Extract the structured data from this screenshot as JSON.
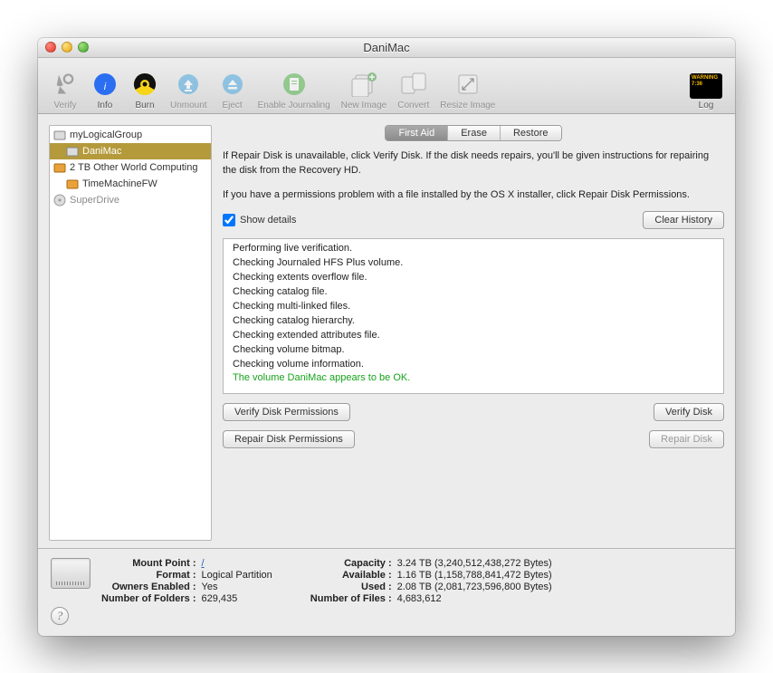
{
  "window": {
    "title": "DaniMac"
  },
  "toolbar": {
    "items": [
      {
        "id": "verify",
        "label": "Verify",
        "enabled": false
      },
      {
        "id": "info",
        "label": "Info",
        "enabled": true
      },
      {
        "id": "burn",
        "label": "Burn",
        "enabled": true
      },
      {
        "id": "unmount",
        "label": "Unmount",
        "enabled": false
      },
      {
        "id": "eject",
        "label": "Eject",
        "enabled": false
      },
      {
        "id": "journal",
        "label": "Enable Journaling",
        "enabled": false
      },
      {
        "id": "newimage",
        "label": "New Image",
        "enabled": false
      },
      {
        "id": "convert",
        "label": "Convert",
        "enabled": false
      },
      {
        "id": "resize",
        "label": "Resize Image",
        "enabled": false
      }
    ],
    "log_label": "Log",
    "log_text": "WARNING 7:36"
  },
  "sidebar": {
    "items": [
      {
        "label": "myLogicalGroup",
        "icon": "volume",
        "indent": 0,
        "selected": false,
        "dim": false
      },
      {
        "label": "DaniMac",
        "icon": "volume",
        "indent": 1,
        "selected": true,
        "dim": false
      },
      {
        "label": "2 TB Other World Computing",
        "icon": "disk-orange",
        "indent": 0,
        "selected": false,
        "dim": false
      },
      {
        "label": "TimeMachineFW",
        "icon": "disk-orange",
        "indent": 1,
        "selected": false,
        "dim": false
      },
      {
        "label": "SuperDrive",
        "icon": "optical",
        "indent": 0,
        "selected": false,
        "dim": true
      }
    ]
  },
  "tabs": {
    "items": [
      {
        "label": "First Aid",
        "active": true
      },
      {
        "label": "Erase",
        "active": false
      },
      {
        "label": "Restore",
        "active": false
      }
    ]
  },
  "panel": {
    "instructions_1": "If Repair Disk is unavailable, click Verify Disk. If the disk needs repairs, you'll be given instructions for repairing the disk from the Recovery HD.",
    "instructions_2": "If you have a permissions problem with a file installed by the OS X installer, click Repair Disk Permissions.",
    "show_details_label": "Show details",
    "show_details_checked": true,
    "clear_history_label": "Clear History",
    "log": [
      "Performing live verification.",
      "Checking Journaled HFS Plus volume.",
      "Checking extents overflow file.",
      "Checking catalog file.",
      "Checking multi-linked files.",
      "Checking catalog hierarchy.",
      "Checking extended attributes file.",
      "Checking volume bitmap.",
      "Checking volume information.",
      "The volume DaniMac appears to be OK."
    ],
    "log_ok_index": 9,
    "verify_perm_label": "Verify Disk Permissions",
    "repair_perm_label": "Repair Disk Permissions",
    "verify_disk_label": "Verify Disk",
    "repair_disk_label": "Repair Disk",
    "repair_disk_enabled": false
  },
  "footer": {
    "left": [
      {
        "k": "Mount Point",
        "v": "/",
        "link": true
      },
      {
        "k": "Format",
        "v": "Logical Partition"
      },
      {
        "k": "Owners Enabled",
        "v": "Yes"
      },
      {
        "k": "Number of Folders",
        "v": "629,435"
      }
    ],
    "right": [
      {
        "k": "Capacity",
        "v": "3.24 TB (3,240,512,438,272 Bytes)"
      },
      {
        "k": "Available",
        "v": "1.16 TB (1,158,788,841,472 Bytes)"
      },
      {
        "k": "Used",
        "v": "2.08 TB (2,081,723,596,800 Bytes)"
      },
      {
        "k": "Number of Files",
        "v": "4,683,612"
      }
    ]
  }
}
